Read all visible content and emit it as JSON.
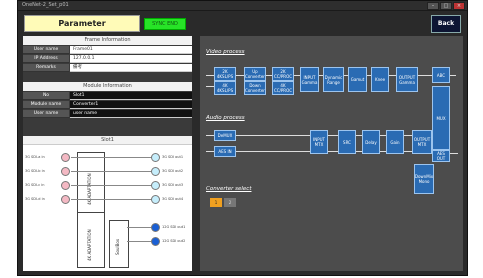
{
  "window": {
    "title": "OneNet-2_Set_p01"
  },
  "header": {
    "parameter_label": "Parameter",
    "sync_label": "SYNC END",
    "back_label": "Back"
  },
  "frame_info": {
    "title": "Frame Information",
    "rows": [
      {
        "label": "User name",
        "value": "Frame01"
      },
      {
        "label": "IP Address",
        "value": "127.0.0.1"
      },
      {
        "label": "Remarks",
        "value": "備考"
      }
    ]
  },
  "module_info": {
    "title": "Module Information",
    "rows": [
      {
        "label": "No",
        "value": "Slot1"
      },
      {
        "label": "Module name",
        "value": "Converter1"
      },
      {
        "label": "User name",
        "value": "user name"
      }
    ]
  },
  "slot": {
    "title": "Slot1",
    "inputs": [
      "3G SDI-a in",
      "3G SDI-b in",
      "3G SDI-c in",
      "3G SDI-d in"
    ],
    "outputs": [
      "3G SDI out1",
      "3G SDI out2",
      "3G SDI out3",
      "3G SDI out4",
      "12G SDI out1",
      "12G SDI out2"
    ],
    "vbox1": "4K ADAPTATION",
    "vbox2": "4K ADAPTATION",
    "vbox3": "SoulBox"
  },
  "video": {
    "label": "Video process",
    "blocks": {
      "b1a": "2K\n4KSL/PS",
      "b1b": "4K\n4KSL/PS",
      "b2a": "Up\nConverter",
      "b2b": "Down\nConverter",
      "b3a": "2K\nCC/PROC",
      "b3b": "4K\nCC/PROC",
      "input": "INPUT\nGamma",
      "dyn": "Dynamic\nRange",
      "gamut": "Gamut",
      "knee": "Knee",
      "output": "OUTPUT\nGamma",
      "abc": "ABC",
      "mux": "MUX"
    }
  },
  "audio": {
    "label": "Audio process",
    "blocks": {
      "demux": "DeMUX",
      "aesin": "AES IN",
      "inmtx": "INPUT\nMTX",
      "src": "SRC",
      "delay": "Delay",
      "gain": "Gain",
      "outmtx": "OUTPUT\nMTX",
      "aesout": "AES\nOUT",
      "downmix": "DownMix\nMono"
    }
  },
  "converter_select": {
    "label": "Converter select",
    "options": [
      "1",
      "2"
    ],
    "selected": "1"
  }
}
